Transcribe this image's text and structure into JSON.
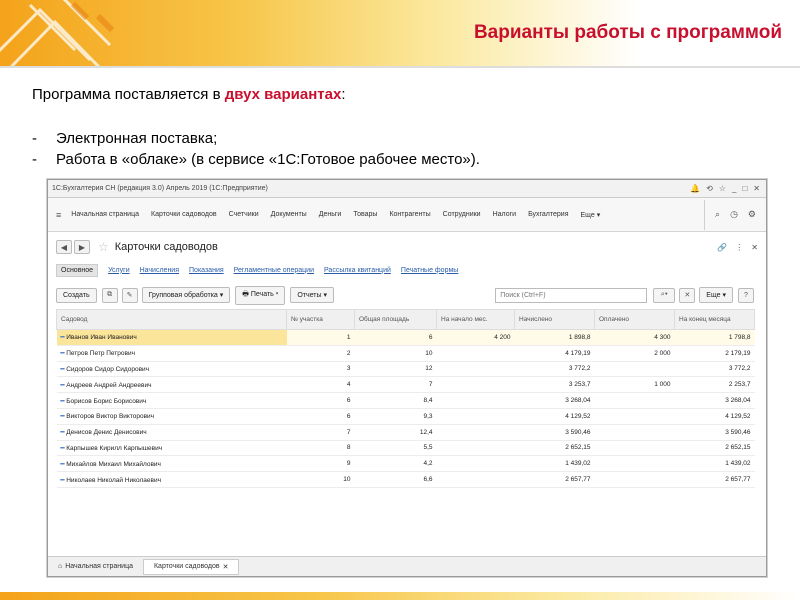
{
  "slide": {
    "title": "Варианты работы с программой",
    "intro_prefix": "Программа поставляется в ",
    "intro_bold": "двух вариантах",
    "intro_suffix": ":",
    "bullets": [
      "Электронная поставка;",
      "Работа в «облаке» (в сервисе «1С:Готовое рабочее место»)."
    ]
  },
  "window": {
    "title": "1С:Бухгалтерия СН (редакция 3.0) Апрель 2019 (1С:Предприятие)",
    "sections": [
      "Начальная страница",
      "Карточки садоводов",
      "Счетчики",
      "Документы",
      "Деньги",
      "Товары",
      "Контрагенты",
      "Сотрудники",
      "Налоги",
      "Бухгалтерия",
      "Еще ▾"
    ],
    "form_title": "Карточки садоводов",
    "links": [
      "Основное",
      "Услуги",
      "Начисления",
      "Показания",
      "Регламентные операции",
      "Рассылка квитанций",
      "Печатные формы"
    ],
    "commands": {
      "create": "Создать",
      "group": "Групповая обработка",
      "print": "Печать",
      "reports": "Отчеты",
      "search_placeholder": "Поиск (Ctrl+F)",
      "more": "Еще"
    },
    "columns": [
      "Садовод",
      "№ участка",
      "Общая площадь",
      "На начало мес.",
      "Начислено",
      "Оплачено",
      "На конец месяца"
    ],
    "rows": [
      [
        "Иванов Иван Иванович",
        "1",
        "6",
        "4 200",
        "1 898,8",
        "4 300",
        "1 798,8"
      ],
      [
        "Петров Петр Петрович",
        "2",
        "10",
        "",
        "4 179,19",
        "2 000",
        "2 179,19"
      ],
      [
        "Сидоров Сидор Сидорович",
        "3",
        "12",
        "",
        "3 772,2",
        "",
        "3 772,2"
      ],
      [
        "Андреев Андрей Андреевич",
        "4",
        "7",
        "",
        "3 253,7",
        "1 000",
        "2 253,7"
      ],
      [
        "Борисов Борис Борисович",
        "6",
        "8,4",
        "",
        "3 268,04",
        "",
        "3 268,04"
      ],
      [
        "Викторов Виктор Викторович",
        "6",
        "9,3",
        "",
        "4 129,52",
        "",
        "4 129,52"
      ],
      [
        "Денисов Денис Денисович",
        "7",
        "12,4",
        "",
        "3 590,46",
        "",
        "3 590,46"
      ],
      [
        "Карпышев Кирилл Карпышевич",
        "8",
        "5,5",
        "",
        "2 652,15",
        "",
        "2 652,15"
      ],
      [
        "Михайлов Михаил Михайлович",
        "9",
        "4,2",
        "",
        "1 439,02",
        "",
        "1 439,02"
      ],
      [
        "Николаев Николай Николаевич",
        "10",
        "6,6",
        "",
        "2 657,77",
        "",
        "2 657,77"
      ]
    ],
    "tabs": [
      "Начальная страница",
      "Карточки садоводов"
    ]
  }
}
